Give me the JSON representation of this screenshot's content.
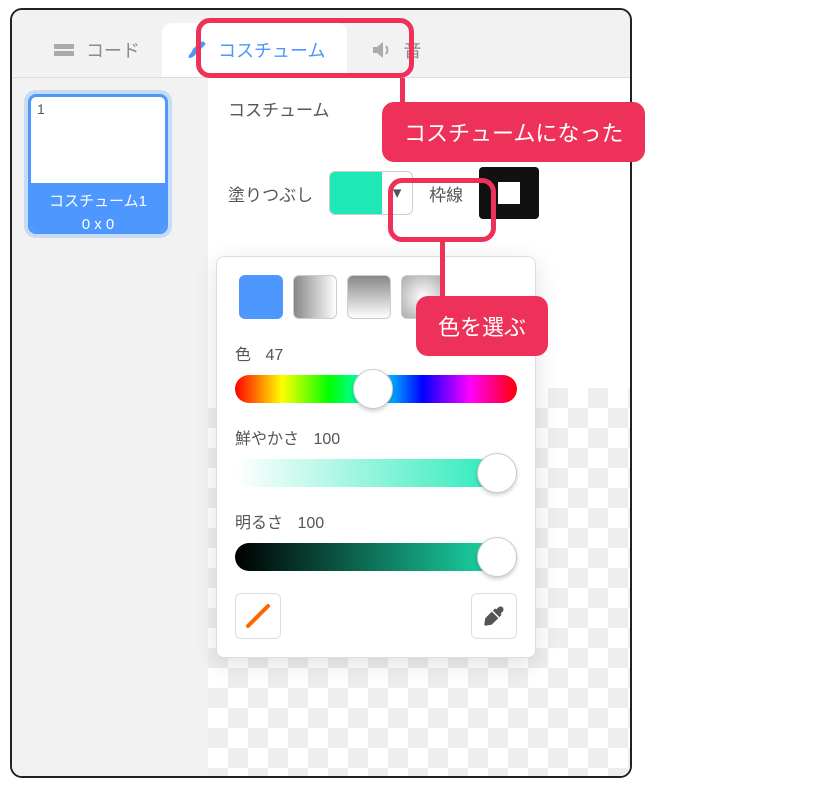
{
  "tabs": {
    "code": "コード",
    "costumes": "コスチューム",
    "sounds": "音"
  },
  "sidebar": {
    "thumb_index": "1",
    "thumb_name": "コスチューム1",
    "thumb_size": "0 x 0"
  },
  "toolbar": {
    "costume_label": "コスチューム",
    "fill_label": "塗りつぶし",
    "outline_label": "枠線",
    "fill_color": "#1ee9b6"
  },
  "color_picker": {
    "hue_label": "色",
    "hue_value": "47",
    "sat_label": "鮮やかさ",
    "sat_value": "100",
    "bri_label": "明るさ",
    "bri_value": "100"
  },
  "callouts": {
    "became_costume": "コスチュームになった",
    "choose_color": "色を選ぶ"
  }
}
